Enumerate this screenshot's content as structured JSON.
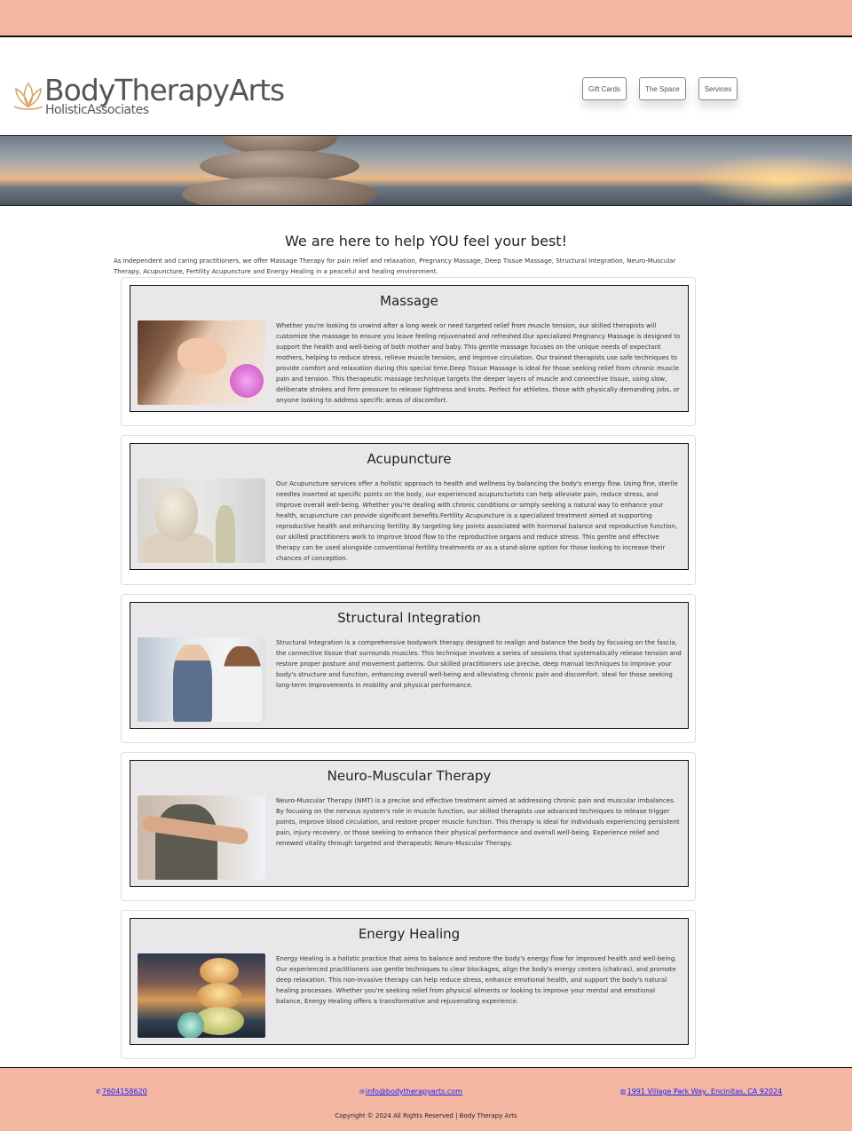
{
  "brand": {
    "title": "BodyTherapyArts",
    "subtitle": "HolisticAssociates"
  },
  "nav": {
    "gift_cards": "Gift Cards",
    "the_space": "The Space",
    "services": "Services"
  },
  "intro": {
    "title": "We are here to help YOU feel your best!",
    "text": "As independent and caring practitioners, we offer Massage Therapy for pain relief and relaxation, Pregnancy Massage, Deep Tissue Massage, Structural Integration, Neuro-Muscular Therapy, Acupuncture, Fertility Acupuncture and Energy Healing in a peaceful and healing environment."
  },
  "services": [
    {
      "title": "Massage",
      "text": "Whether you're looking to unwind after a long week or need targeted relief from muscle tension, our skilled therapists will customize the massage to ensure you leave feeling rejuvenated and refreshed.Our specialized Pregnancy Massage is designed to support the health and well-being of both mother and baby. This gentle massage focuses on the unique needs of expectant mothers, helping to reduce stress, relieve muscle tension, and improve circulation. Our trained therapists use safe techniques to provide comfort and relaxation during this special time.Deep Tissue Massage is ideal for those seeking relief from chronic muscle pain and tension. This therapeutic massage technique targets the deeper layers of muscle and connective tissue, using slow, deliberate strokes and firm pressure to release tightness and knots. Perfect for athletes, those with physically demanding jobs, or anyone looking to address specific areas of discomfort."
    },
    {
      "title": "Acupuncture",
      "text": "Our Acupuncture services offer a holistic approach to health and wellness by balancing the body's energy flow. Using fine, sterile needles inserted at specific points on the body, our experienced acupuncturists can help alleviate pain, reduce stress, and improve overall well-being. Whether you're dealing with chronic conditions or simply seeking a natural way to enhance your health, acupuncture can provide significant benefits.Fertility Acupuncture is a specialized treatment aimed at supporting reproductive health and enhancing fertility. By targeting key points associated with hormonal balance and reproductive function, our skilled practitioners work to improve blood flow to the reproductive organs and reduce stress. This gentle and effective therapy can be used alongside conventional fertility treatments or as a stand-alone option for those looking to increase their chances of conception."
    },
    {
      "title": "Structural Integration",
      "text": "Structural Integration is a comprehensive bodywork therapy designed to realign and balance the body by focusing on the fascia, the connective tissue that surrounds muscles. This technique involves a series of sessions that systematically release tension and restore proper posture and movement patterns. Our skilled practitioners use precise, deep manual techniques to improve your body's structure and function, enhancing overall well-being and alleviating chronic pain and discomfort. Ideal for those seeking long-term improvements in mobility and physical performance."
    },
    {
      "title": "Neuro-Muscular Therapy",
      "text": "Neuro-Muscular Therapy (NMT) is a precise and effective treatment aimed at addressing chronic pain and muscular imbalances. By focusing on the nervous system's role in muscle function, our skilled therapists use advanced techniques to release trigger points, improve blood circulation, and restore proper muscle function. This therapy is ideal for individuals experiencing persistent pain, injury recovery, or those seeking to enhance their physical performance and overall well-being. Experience relief and renewed vitality through targeted and therapeutic Neuro-Muscular Therapy."
    },
    {
      "title": "Energy Healing",
      "text": "Energy Healing is a holistic practice that aims to balance and restore the body's energy flow for improved health and well-being. Our experienced practitioners use gentle techniques to clear blockages, align the body's energy centers (chakras), and promote deep relaxation. This non-invasive therapy can help reduce stress, enhance emotional health, and support the body's natural healing processes. Whether you're seeking relief from physical ailments or looking to improve your mental and emotional balance, Energy Healing offers a transformative and rejuvenating experience."
    }
  ],
  "footer": {
    "phone": "7604158620",
    "email": "info@bodytherapyarts.com",
    "address": "1991 Village Park Way, Encinitas, CA 92024",
    "copyright": "Copyright © 2024 All Rights Reserved | Body Therapy Arts"
  },
  "colors": {
    "accent": "#f4b8a2",
    "card_bg": "#e9e7ea",
    "link": "#1a1aff"
  }
}
